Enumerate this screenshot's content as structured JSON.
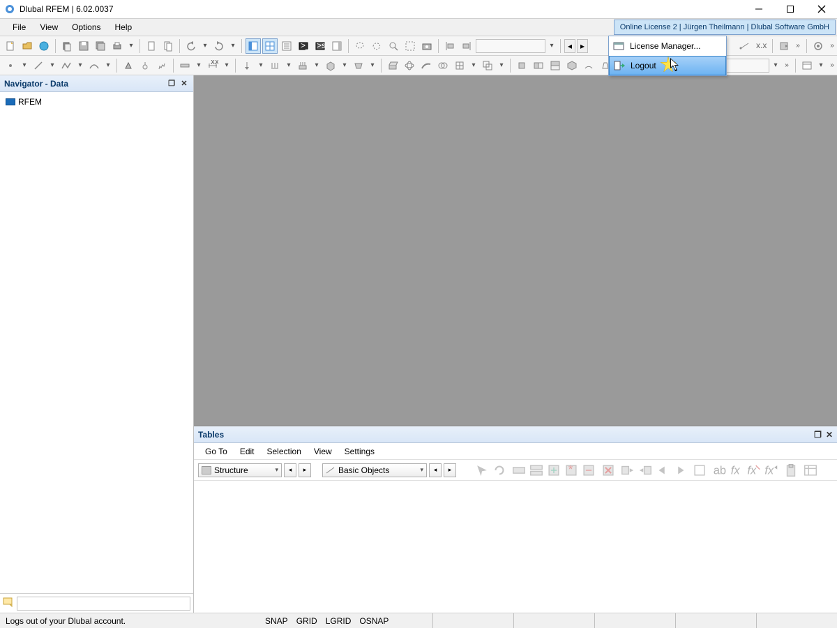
{
  "title": "Dlubal RFEM | 6.02.0037",
  "menu": {
    "file": "File",
    "view": "View",
    "options": "Options",
    "help": "Help"
  },
  "license_badge": "Online License 2 | Jürgen Theilmann | Dlubal Software GmbH",
  "license_menu": {
    "manager": "License Manager...",
    "logout": "Logout"
  },
  "navigator": {
    "title": "Navigator - Data",
    "root": "RFEM"
  },
  "tables": {
    "title": "Tables",
    "menu": {
      "goto": "Go To",
      "edit": "Edit",
      "selection": "Selection",
      "view": "View",
      "settings": "Settings"
    },
    "combo1": "Structure",
    "combo2": "Basic Objects"
  },
  "statusbar": {
    "hint": "Logs out of your Dlubal account.",
    "snap": "SNAP",
    "grid": "GRID",
    "lgrid": "LGRID",
    "osnap": "OSNAP"
  }
}
